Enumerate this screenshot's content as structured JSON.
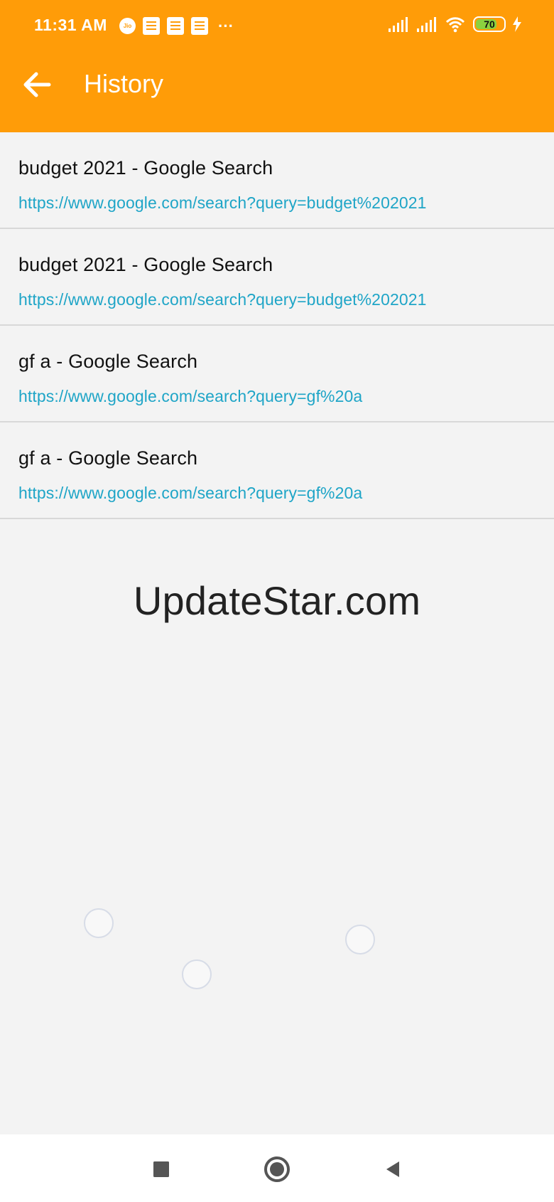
{
  "status_bar": {
    "time": "11:31 AM",
    "carrier_icon": "jio-icon",
    "notification_icons": [
      "document-icon",
      "document-icon",
      "document-icon"
    ],
    "more_icon": "···",
    "battery": "70"
  },
  "header": {
    "back_icon": "back-arrow-icon",
    "title": "History",
    "background": "#ff9c08"
  },
  "history": {
    "items": [
      {
        "title": "budget 2021 - Google Search",
        "url": "https://www.google.com/search?query=budget%202021"
      },
      {
        "title": "budget 2021 - Google Search",
        "url": "https://www.google.com/search?query=budget%202021"
      },
      {
        "title": "gf a - Google Search",
        "url": "https://www.google.com/search?query=gf%20a"
      },
      {
        "title": "gf a - Google Search",
        "url": "https://www.google.com/search?query=gf%20a"
      }
    ],
    "url_color": "#1fa5c7"
  },
  "watermark": "UpdateStar.com",
  "navigation": {
    "recent_icon": "square-icon",
    "home_icon": "circle-icon",
    "back_icon": "triangle-back-icon"
  }
}
